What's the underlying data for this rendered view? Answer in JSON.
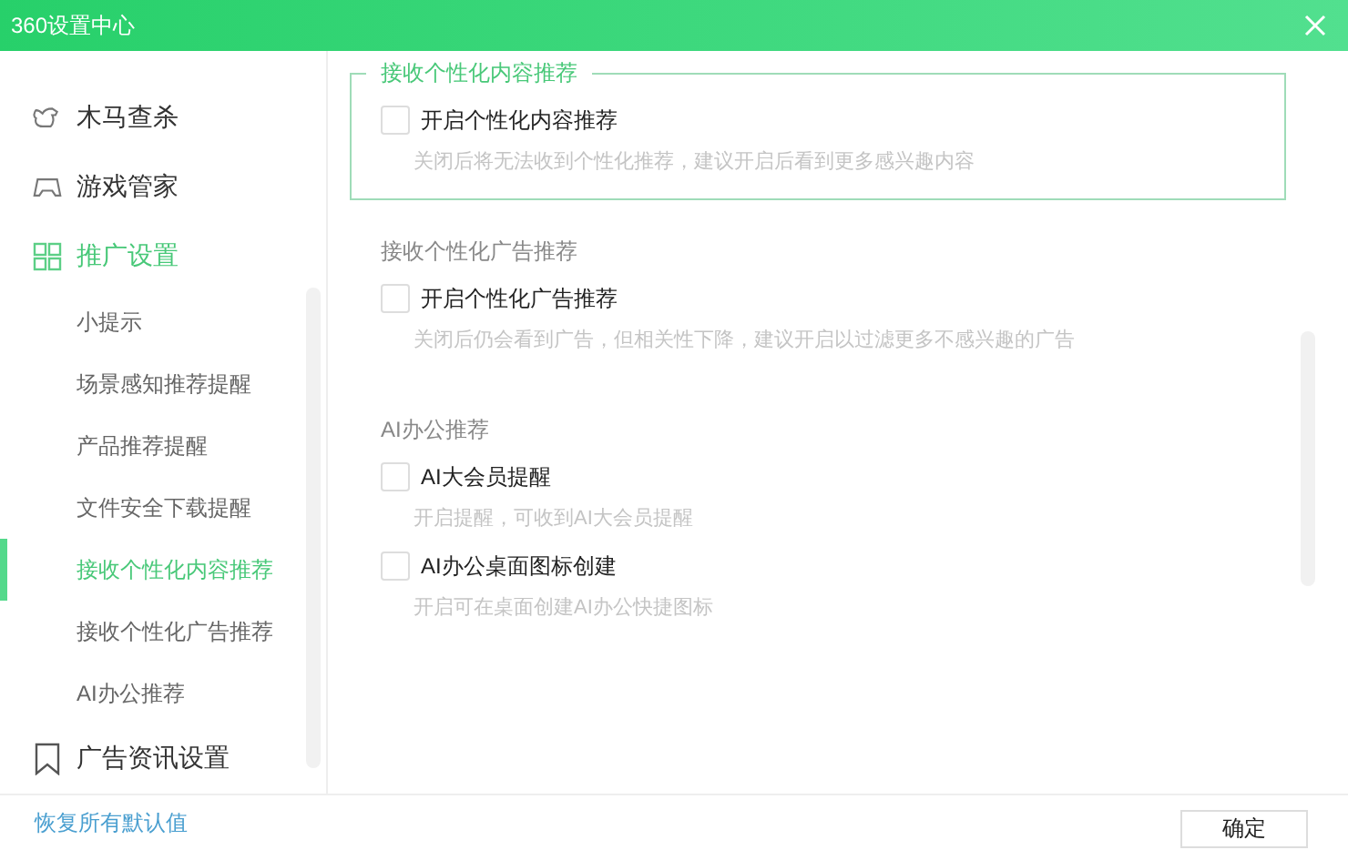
{
  "window": {
    "title": "360设置中心"
  },
  "sidebar": {
    "items": [
      {
        "label": "木马查杀",
        "expanded": false
      },
      {
        "label": "游戏管家",
        "expanded": false
      },
      {
        "label": "推广设置",
        "expanded": true,
        "children": [
          {
            "label": "小提示",
            "selected": false
          },
          {
            "label": "场景感知推荐提醒",
            "selected": false
          },
          {
            "label": "产品推荐提醒",
            "selected": false
          },
          {
            "label": "文件安全下载提醒",
            "selected": false
          },
          {
            "label": "接收个性化内容推荐",
            "selected": true
          },
          {
            "label": "接收个性化广告推荐",
            "selected": false
          },
          {
            "label": "AI办公推荐",
            "selected": false
          }
        ]
      },
      {
        "label": "广告资讯设置",
        "expanded": false
      }
    ]
  },
  "sections": [
    {
      "title": "接收个性化内容推荐",
      "highlighted": true,
      "options": [
        {
          "label": "开启个性化内容推荐",
          "checked": false,
          "description": "关闭后将无法收到个性化推荐，建议开启后看到更多感兴趣内容"
        }
      ]
    },
    {
      "title": "接收个性化广告推荐",
      "highlighted": false,
      "options": [
        {
          "label": "开启个性化广告推荐",
          "checked": false,
          "description": "关闭后仍会看到广告，但相关性下降，建议开启以过滤更多不感兴趣的广告"
        }
      ]
    },
    {
      "title": "AI办公推荐",
      "highlighted": false,
      "options": [
        {
          "label": "AI大会员提醒",
          "checked": false,
          "description": "开启提醒，可收到AI大会员提醒"
        },
        {
          "label": "AI办公桌面图标创建",
          "checked": false,
          "description": "开启可在桌面创建AI办公快捷图标"
        }
      ]
    }
  ],
  "footer": {
    "reset_link": "恢复所有默认值",
    "confirm_button": "确定"
  }
}
